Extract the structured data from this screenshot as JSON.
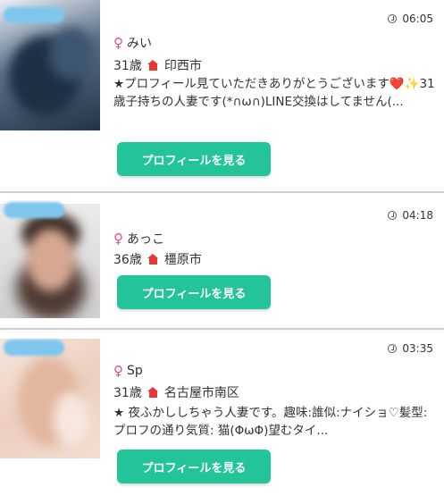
{
  "colors": {
    "accent_button": "#23c49a",
    "female_icon": "#ea4c89",
    "home_icon": "#e53935",
    "badge": "#7ec6ee"
  },
  "profiles": [
    {
      "time": "06:05",
      "name": "みい",
      "age": "31歳",
      "location": "印西市",
      "bio": "★プロフィール見ていただきありがとうございます❤️✨31歳子持ちの人妻です(*∩ω∩)LINE交換はしてません(...",
      "button_label": "プロフィールを見る"
    },
    {
      "time": "04:18",
      "name": "あっこ",
      "age": "36歳",
      "location": "橿原市",
      "bio": "",
      "button_label": "プロフィールを見る"
    },
    {
      "time": "03:35",
      "name": "Sp",
      "age": "31歳",
      "location": "名古屋市南区",
      "bio": "★ 夜ふかししちゃう人妻です。趣味:誰似:ナイショ♡髪型:プロフの通り気質: 猫(ΦωΦ)望むタイ...",
      "button_label": "プロフィールを見る"
    }
  ]
}
